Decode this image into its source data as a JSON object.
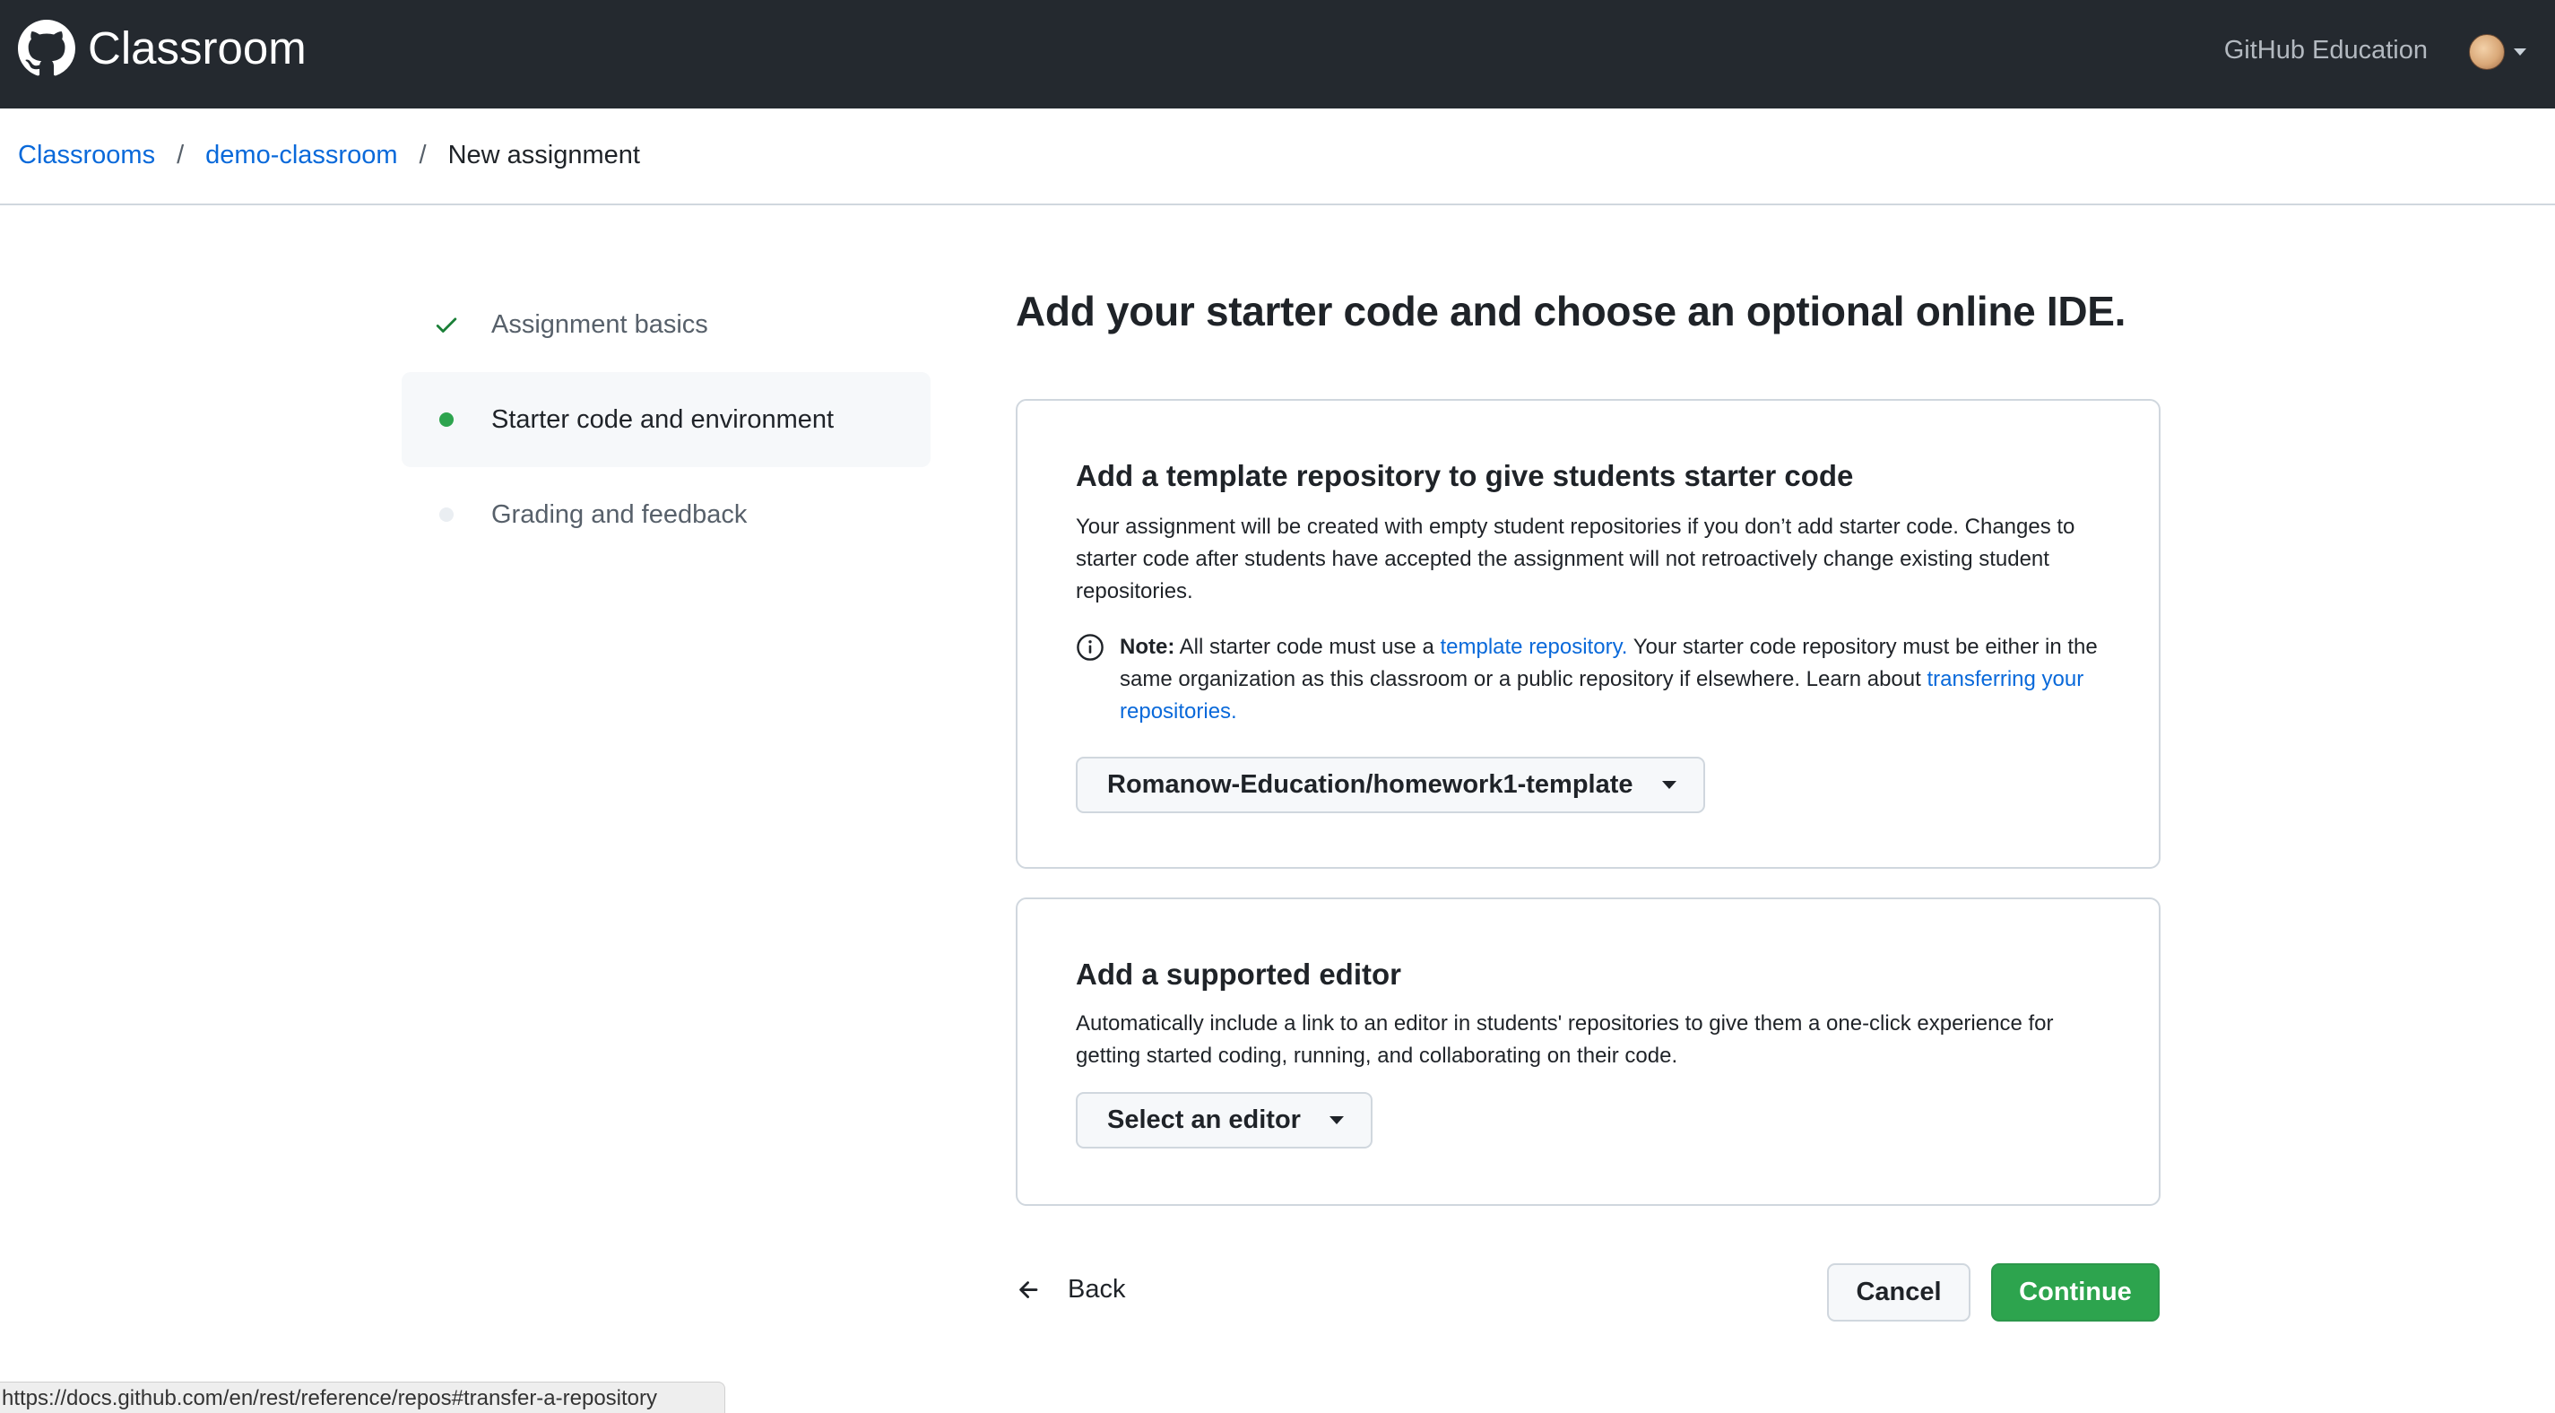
{
  "header": {
    "app_name": "Classroom",
    "education_link": "GitHub Education",
    "avatar_alt": "user avatar"
  },
  "breadcrumb": {
    "items": [
      "Classrooms",
      "demo-classroom"
    ],
    "separator": "/",
    "current": "New assignment"
  },
  "sidebar": {
    "steps": [
      {
        "label": "Assignment basics",
        "state": "complete"
      },
      {
        "label": "Starter code and environment",
        "state": "active"
      },
      {
        "label": "Grading and feedback",
        "state": "pending"
      }
    ]
  },
  "main": {
    "title": "Add your starter code and choose an optional online IDE.",
    "template_card": {
      "heading": "Add a template repository to give students starter code",
      "description": "Your assignment will be created with empty student repositories if you don’t add starter code. Changes to starter code after students have accepted the assignment will not retroactively change existing student repositories.",
      "note_label": "Note:",
      "note_text_1": "All starter code must use a",
      "note_link_1": "template repository.",
      "note_text_2": "Your starter code repository must be either in the same organization as this classroom or a public repository if elsewhere. Learn about",
      "note_link_2": "transferring your repositories.",
      "selected_repo": "Romanow-Education/homework1-template"
    },
    "editor_card": {
      "heading": "Add a supported editor",
      "description": "Automatically include a link to an editor in students' repositories to give them a one-click experience for getting started coding, running, and collaborating on their code.",
      "select_label": "Select an editor"
    }
  },
  "actions": {
    "back": "Back",
    "cancel": "Cancel",
    "continue": "Continue"
  },
  "status_url": "https://docs.github.com/en/rest/reference/repos#transfer-a-repository",
  "colors": {
    "header_bg": "#24292f",
    "link": "#0969da",
    "success": "#2da44e"
  }
}
